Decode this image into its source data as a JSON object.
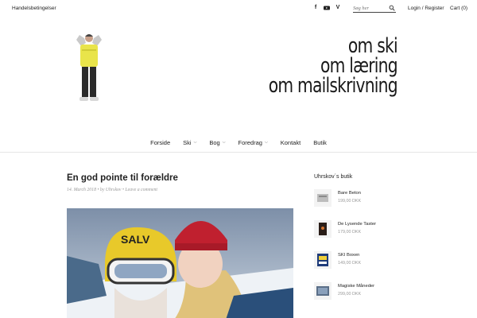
{
  "topbar": {
    "terms_link": "Handelsbetingelser",
    "search_placeholder": "Søg her",
    "login_label": "Login / Register",
    "cart_label": "Cart (0)",
    "social_icons": [
      "facebook-icon",
      "youtube-icon",
      "vimeo-icon"
    ]
  },
  "header": {
    "tagline_lines": [
      "om ski",
      "om læring",
      "om mailskrivning"
    ]
  },
  "nav": {
    "items": [
      {
        "label": "Forside",
        "has_dropdown": false
      },
      {
        "label": "Ski",
        "has_dropdown": true
      },
      {
        "label": "Bog",
        "has_dropdown": true
      },
      {
        "label": "Foredrag",
        "has_dropdown": true
      },
      {
        "label": "Kontakt",
        "has_dropdown": false
      },
      {
        "label": "Butik",
        "has_dropdown": false
      }
    ]
  },
  "post": {
    "title": "En god pointe til forældre",
    "date": "14. March 2018",
    "author": "by Uhrskov",
    "comment_link": "Leave a comment",
    "image_text": "SALV"
  },
  "sidebar": {
    "title": "Uhrskov´s butik",
    "products": [
      {
        "name": "Bare Beton",
        "price": "199,00 DKK"
      },
      {
        "name": "De Lysende Taster",
        "price": "179,00 DKK"
      },
      {
        "name": "SKI Boxen",
        "price": "149,00 DKK"
      },
      {
        "name": "Magiske Måneder",
        "price": "299,00 DKK"
      }
    ]
  },
  "colors": {
    "text": "#222222",
    "muted": "#999999",
    "rule": "#e6e6e6"
  }
}
